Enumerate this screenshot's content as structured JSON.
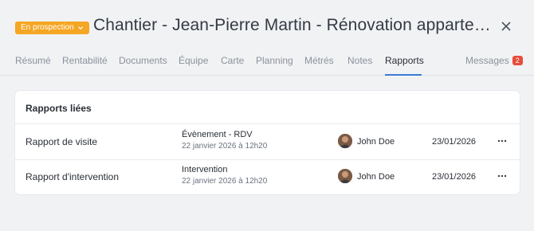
{
  "header": {
    "status": "En prospection",
    "title": "Chantier - Jean-Pierre Martin - Rénovation appartement …"
  },
  "tabs": [
    {
      "label": "Résumé"
    },
    {
      "label": "Rentabilité"
    },
    {
      "label": "Documents"
    },
    {
      "label": "Équipe"
    },
    {
      "label": "Carte"
    },
    {
      "label": "Planning"
    },
    {
      "label": "Métrés"
    },
    {
      "label": "Notes"
    },
    {
      "label": "Rapports"
    },
    {
      "label": "Messages",
      "badge": "2"
    }
  ],
  "active_tab": "Rapports",
  "colors": {
    "status": "#f5a623",
    "accent": "#3a7bd5",
    "badge": "#e74c3c"
  },
  "card": {
    "title": "Rapports liées",
    "rows": [
      {
        "name": "Rapport de visite",
        "type": "Évènement - RDV",
        "datetime": "22 janvier 2026 à 12h20",
        "user": "John Doe",
        "date": "23/01/2026"
      },
      {
        "name": "Rapport d'intervention",
        "type": "Intervention",
        "datetime": "22 janvier 2026 à 12h20",
        "user": "John Doe",
        "date": "23/01/2026"
      }
    ]
  }
}
